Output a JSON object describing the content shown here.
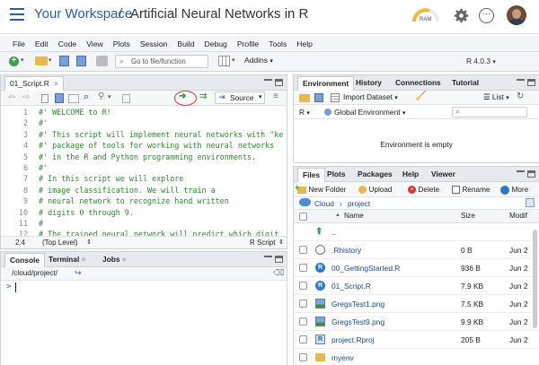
{
  "header": {
    "workspace": "Your Workspace",
    "separator": "/",
    "project": "Artificial Neural Networks in R",
    "ram_label": "RAM"
  },
  "menu": [
    "File",
    "Edit",
    "Code",
    "View",
    "Plots",
    "Session",
    "Build",
    "Debug",
    "Profile",
    "Tools",
    "Help"
  ],
  "toolbar": {
    "goto_placeholder": "Go to file/function",
    "addins": "Addins",
    "r_version": "R 4.0.3"
  },
  "editor": {
    "tab": "01_Script.R",
    "source_label": "Source",
    "lines": [
      {
        "n": "1",
        "t": "#' WELCOME to R!"
      },
      {
        "n": "2",
        "t": "#'"
      },
      {
        "n": "3",
        "t": "#' This script will implement neural networks with \"ke"
      },
      {
        "n": "4",
        "t": "#' package of tools for working with neural networks"
      },
      {
        "n": "5",
        "t": "#' in the R and Python programming environments."
      },
      {
        "n": "6",
        "t": "#'"
      },
      {
        "n": "7",
        "t": "# In this script we will explore"
      },
      {
        "n": "8",
        "t": "# image classification. We will train a"
      },
      {
        "n": "9",
        "t": "# neural network to recognize hand written"
      },
      {
        "n": "10",
        "t": "# digits 0 through 9."
      },
      {
        "n": "11",
        "t": "#"
      },
      {
        "n": "12",
        "t": "# The trained neural network will predict which digit"
      }
    ],
    "status_pos": "2:4",
    "status_scope": "(Top Level)",
    "status_type": "R Script"
  },
  "console": {
    "tabs": [
      "Console",
      "Terminal",
      "Jobs"
    ],
    "path": "/cloud/project/",
    "prompt": ">"
  },
  "env": {
    "tabs": [
      "Environment",
      "History",
      "Connections",
      "Tutorial"
    ],
    "import_dataset": "Import Dataset",
    "list": "List",
    "lang": "R",
    "global_env": "Global Environment",
    "empty_msg": "Environment is empty"
  },
  "files": {
    "tabs": [
      "Files",
      "Plots",
      "Packages",
      "Help",
      "Viewer"
    ],
    "actions": {
      "new_folder": "New Folder",
      "upload": "Upload",
      "delete": "Delete",
      "rename": "Rename",
      "more": "More"
    },
    "breadcrumb": {
      "cloud": "Cloud",
      "sep": "›",
      "project": "project"
    },
    "columns": {
      "name": "Name",
      "size": "Size",
      "modified": "Modif"
    },
    "up": "..",
    "rows": [
      {
        "name": ".Rhistory",
        "size": "0 B",
        "mod": "Jun 2",
        "icon": "history-file"
      },
      {
        "name": "00_GettingStarted.R",
        "size": "936 B",
        "mod": "Jun 2",
        "icon": "r-file"
      },
      {
        "name": "01_Script.R",
        "size": "7.9 KB",
        "mod": "Jun 2",
        "icon": "r-file"
      },
      {
        "name": "GregsTest1.png",
        "size": "7.5 KB",
        "mod": "Jun 2",
        "icon": "image-file"
      },
      {
        "name": "GregsTest9.png",
        "size": "9.9 KB",
        "mod": "Jun 2",
        "icon": "image-file"
      },
      {
        "name": "project.Rproj",
        "size": "205 B",
        "mod": "Jun 2",
        "icon": "rproj-file"
      },
      {
        "name": "myenv",
        "size": "",
        "mod": "",
        "icon": "folder"
      }
    ]
  },
  "colors": {
    "accent": "#2a5db0",
    "highlight": "#e03a2f",
    "green": "#2d8a2d"
  }
}
